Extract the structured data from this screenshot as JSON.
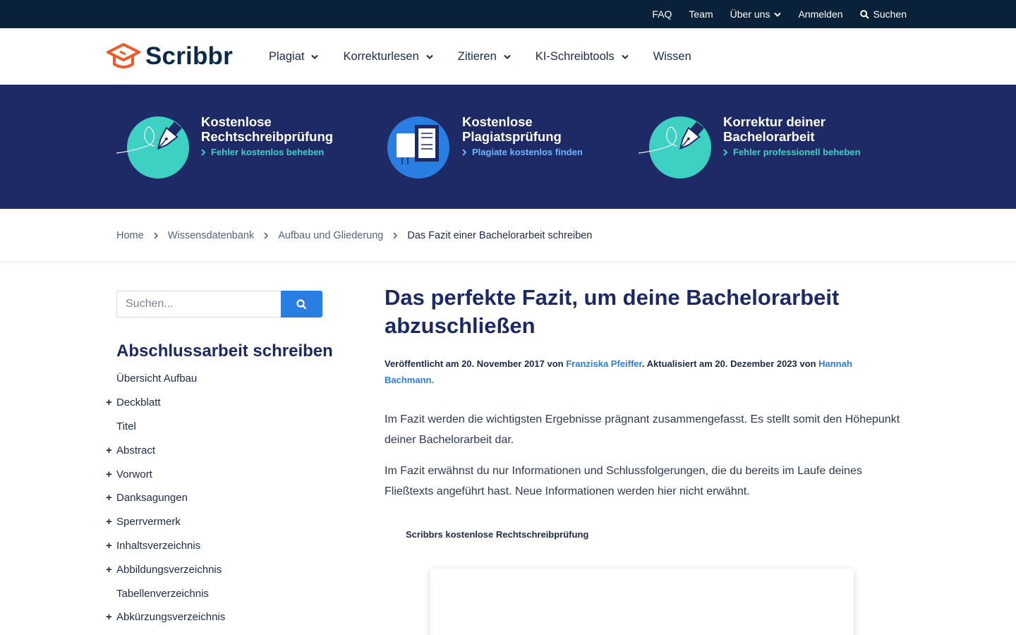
{
  "topbar": {
    "faq": "FAQ",
    "team": "Team",
    "about": "Über uns",
    "login": "Anmelden",
    "search": "Suchen"
  },
  "header": {
    "logo_text": "Scribbr",
    "nav": [
      {
        "label": "Plagiat"
      },
      {
        "label": "Korrekturlesen"
      },
      {
        "label": "Zitieren"
      },
      {
        "label": "KI-Schreibtools"
      },
      {
        "label": "Wissen"
      }
    ]
  },
  "promo": [
    {
      "title": "Kostenlose\nRechtschreibprüfung",
      "link": "Fehler kostenlos beheben",
      "icon": "fountain-pen-icon"
    },
    {
      "title": "Kostenlose\nPlagiatsprüfung",
      "link": "Plagiate kostenlos finden",
      "icon": "document-compare-icon"
    },
    {
      "title": "Korrektur deiner\nBachelorarbeit",
      "link": "Fehler professionell beheben",
      "icon": "fountain-pen-icon"
    }
  ],
  "breadcrumb": {
    "home": "Home",
    "level1": "Wissensdatenbank",
    "level2": "Aufbau und Gliederung",
    "current": "Das Fazit einer Bachelorarbeit schreiben"
  },
  "sidebar": {
    "search_placeholder": "Suchen...",
    "title": "Abschlussarbeit schreiben",
    "items": [
      {
        "label": "Übersicht Aufbau",
        "expandable": false
      },
      {
        "label": "Deckblatt",
        "expandable": true
      },
      {
        "label": "Titel",
        "expandable": false
      },
      {
        "label": "Abstract",
        "expandable": true
      },
      {
        "label": "Vorwort",
        "expandable": true
      },
      {
        "label": "Danksagungen",
        "expandable": true
      },
      {
        "label": "Sperrvermerk",
        "expandable": true
      },
      {
        "label": "Inhaltsverzeichnis",
        "expandable": true
      },
      {
        "label": "Abbildungsverzeichnis",
        "expandable": true
      },
      {
        "label": "Tabellenverzeichnis",
        "expandable": false
      },
      {
        "label": "Abkürzungsverzeichnis",
        "expandable": true
      }
    ]
  },
  "article": {
    "title": "Das perfekte Fazit, um deine Bachelorarbeit abzuschließen",
    "meta": {
      "published_prefix": "Veröffentlicht am 20. November 2017 von ",
      "author": "Franziska Pfeiffer",
      "updated_prefix": ". Aktualisiert am 20. Dezember 2023 von ",
      "updater": "Hannah Bachmann."
    },
    "paragraphs": [
      "Im Fazit werden die wichtigsten Ergebnisse prägnant zusammengefasst. Es stellt somit den Höhepunkt deiner Bachelorarbeit dar.",
      "Im Fazit erwähnst du nur Informationen und Schlussfolgerungen, die du bereits im Laufe deines Fließtexts angeführt hast. Neue Informationen werden hier nicht erwähnt."
    ],
    "tool_label": "Scribbrs kostenlose Rechtschreibprüfung"
  },
  "colors": {
    "topbar_bg": "#0a2239",
    "promo_bg": "#1e2a66",
    "accent_teal": "#3ed1c3",
    "accent_blue": "#2a7de1",
    "brand_orange": "#f05a28",
    "heading_navy": "#1b2a66"
  }
}
